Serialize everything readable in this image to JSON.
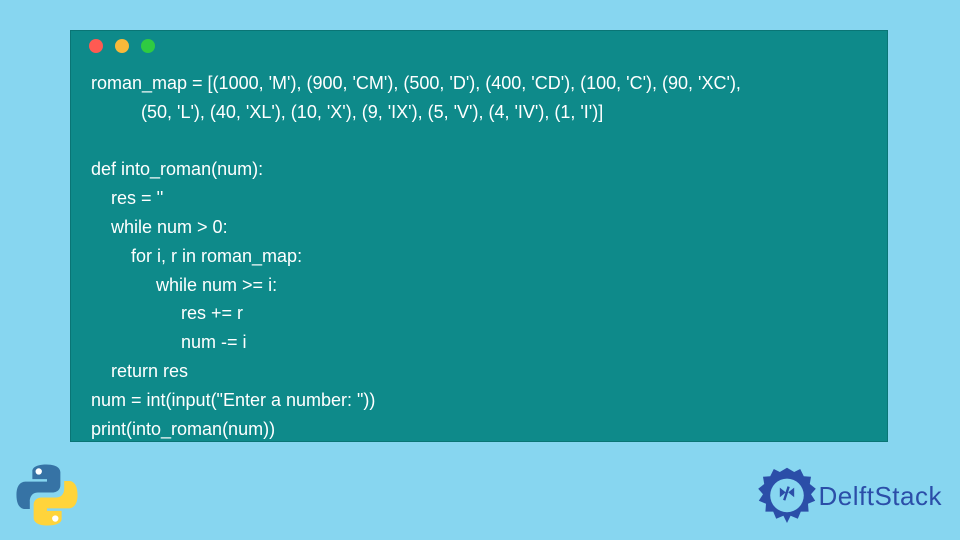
{
  "code": {
    "line1": "roman_map = [(1000, 'M'), (900, 'CM'), (500, 'D'), (400, 'CD'), (100, 'C'), (90, 'XC'),",
    "line2": "          (50, 'L'), (40, 'XL'), (10, 'X'), (9, 'IX'), (5, 'V'), (4, 'IV'), (1, 'I')]",
    "line3": "",
    "line4": "def into_roman(num):",
    "line5": "    res = ''",
    "line6": "    while num > 0:",
    "line7": "        for i, r in roman_map:",
    "line8": "             while num >= i:",
    "line9": "                  res += r",
    "line10": "                  num -= i",
    "line11": "    return res",
    "line12": "num = int(input(\"Enter a number: \"))",
    "line13": "print(into_roman(num))"
  },
  "brand": {
    "name": "DelftStack"
  },
  "icons": {
    "python": "python-logo",
    "brand": "delftstack-gear-icon"
  }
}
